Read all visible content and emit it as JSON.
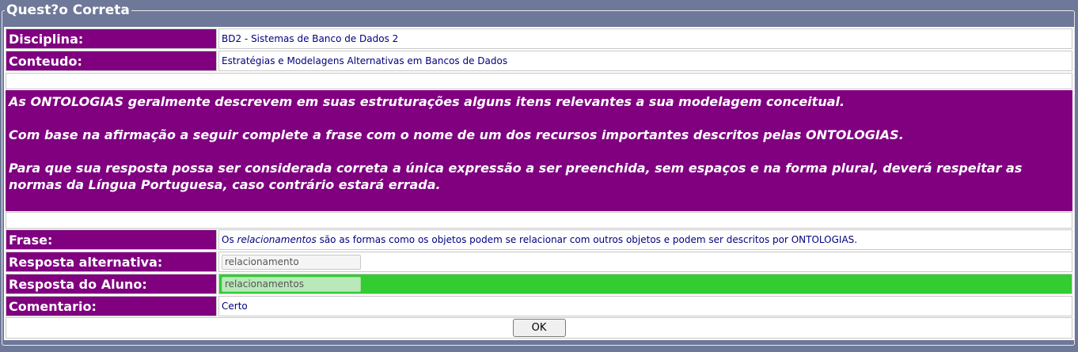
{
  "legend": "Quest?o Correta",
  "disciplina": {
    "label": "Disciplina:",
    "value": "BD2 - Sistemas de Banco de Dados 2"
  },
  "conteudo": {
    "label": "Conteudo:",
    "value": "Estratégias e Modelagens Alternativas em Bancos de Dados"
  },
  "question": {
    "p1": "As ONTOLOGIAS geralmente descrevem em suas estruturações alguns itens relevantes a sua modelagem conceitual.",
    "p2": "Com base na afirmação a seguir complete a frase com o nome de um dos recursos importantes descritos pelas ONTOLOGIAS.",
    "p3": "Para que sua resposta possa ser considerada correta a única expressão a ser preenchida, sem espaços e na forma plural, deverá respeitar as normas da Língua Portuguesa, caso contrário estará errada."
  },
  "frase": {
    "label": "Frase:",
    "prefix": "Os",
    "highlight": "relacionamentos",
    "suffix": "são as formas como os objetos podem se relacionar com outros objetos e podem ser descritos por ONTOLOGIAS."
  },
  "resposta_alternativa": {
    "label": "Resposta alternativa:",
    "value": "relacionamento"
  },
  "resposta_aluno": {
    "label": "Resposta do Aluno:",
    "value": "relacionamentos"
  },
  "comentario": {
    "label": "Comentario:",
    "value": "Certo"
  },
  "ok_button": "OK",
  "colors": {
    "label_bg": "#800080",
    "page_bg": "#6e7898",
    "correct_bg": "#33cc33",
    "value_text": "#000080"
  }
}
